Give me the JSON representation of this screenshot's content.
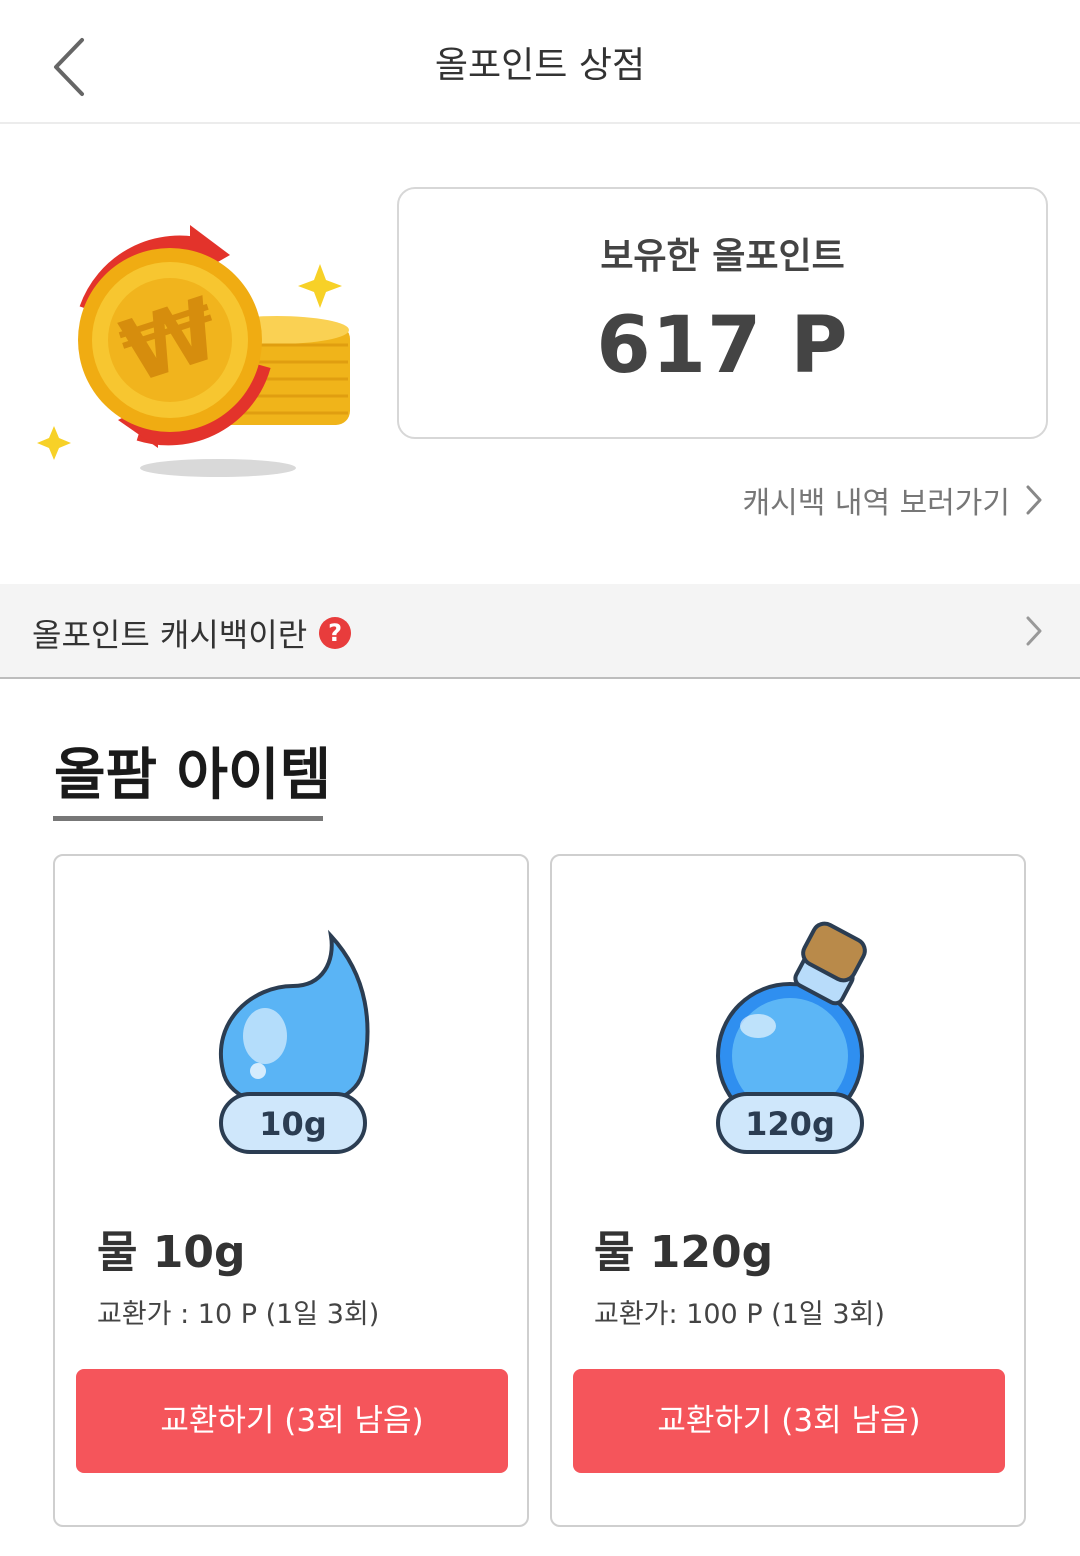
{
  "header": {
    "title": "올포인트 상점",
    "back_icon": "chevron-left-icon"
  },
  "points": {
    "label": "보유한 올포인트",
    "value": "617 P"
  },
  "history_link": {
    "label": "캐시백 내역 보러가기",
    "icon": "chevron-right-icon"
  },
  "info_bar": {
    "label": "올포인트 캐시백이란",
    "help_glyph": "?",
    "icon": "chevron-right-icon"
  },
  "section": {
    "title": "올팜 아이템"
  },
  "items": [
    {
      "badge": "10g",
      "name": "물 10g",
      "price": "교환가 : 10 P (1일 3회)",
      "button": "교환하기 (3회 남음)",
      "icon": "water-drop-icon"
    },
    {
      "badge": "120g",
      "name": "물 120g",
      "price": "교환가: 100 P (1일 3회)",
      "button": "교환하기 (3회 남음)",
      "icon": "water-bottle-icon"
    }
  ],
  "colors": {
    "accent": "#f5555b",
    "coin": "#f5c21e",
    "arrow": "#e3332b",
    "water": "#3da3f2"
  }
}
